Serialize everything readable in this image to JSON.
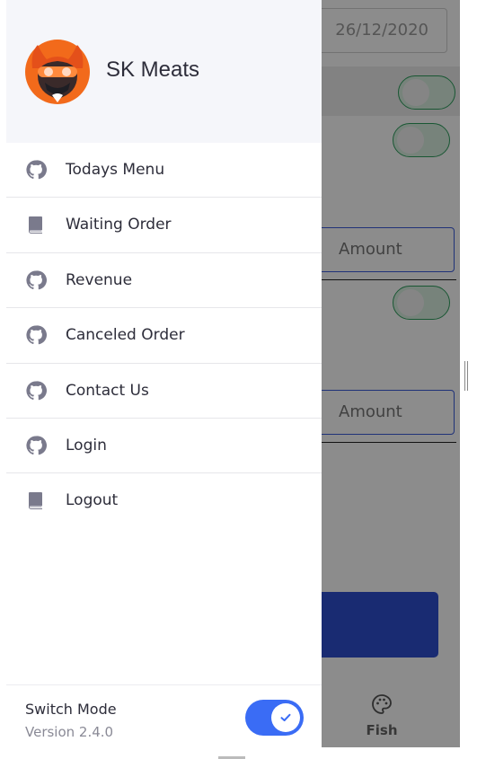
{
  "background": {
    "date_value": "26/12/2020",
    "amount_placeholder": "Amount",
    "tab_fish": "Fish"
  },
  "drawer": {
    "brand": "SK Meats",
    "items": [
      {
        "label": "Todays Menu",
        "icon": "github-icon"
      },
      {
        "label": "Waiting Order",
        "icon": "book-icon"
      },
      {
        "label": "Revenue",
        "icon": "github-icon"
      },
      {
        "label": "Canceled Order",
        "icon": "github-icon"
      },
      {
        "label": "Contact Us",
        "icon": "github-icon"
      },
      {
        "label": "Login",
        "icon": "github-icon"
      },
      {
        "label": "Logout",
        "icon": "book-icon"
      }
    ],
    "footer": {
      "mode_label": "Switch Mode",
      "version": "Version 2.4.0",
      "dark_mode_on": true
    }
  },
  "colors": {
    "accent": "#3a6cf5",
    "icon": "#7a7a8c",
    "text": "#2d2d3a"
  }
}
